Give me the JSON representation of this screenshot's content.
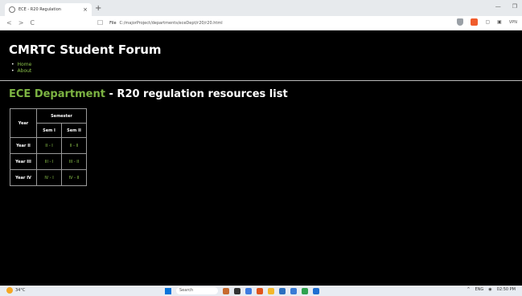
{
  "browser": {
    "tab_title": "ECE - R20 Regulation",
    "tab_close": "×",
    "new_tab": "+",
    "nav_back": "<",
    "nav_forward": ">",
    "nav_reload": "C",
    "address_prefix": "File",
    "address_url": "C:/majorProject/departments/eceDept/r20/r20.html",
    "vpn_label": "VPN"
  },
  "site": {
    "title": "CMRTC Student Forum",
    "nav": [
      "Home",
      "About"
    ]
  },
  "heading": {
    "department": "ECE Department",
    "rest": " - R20 regulation resources list"
  },
  "table": {
    "year_header": "Year",
    "semester_header": "Semester",
    "sem_headers": [
      "Sem I",
      "Sem II"
    ],
    "rows": [
      {
        "year": "Year II",
        "s1": "II - I",
        "s2": "II - II"
      },
      {
        "year": "Year III",
        "s1": "III - I",
        "s2": "III - II"
      },
      {
        "year": "Year IV",
        "s1": "IV - I",
        "s2": "IV - II"
      }
    ]
  },
  "taskbar": {
    "weather": "34°C",
    "search_placeholder": "Search",
    "lang": "ENG",
    "time": "02:50 PM"
  }
}
